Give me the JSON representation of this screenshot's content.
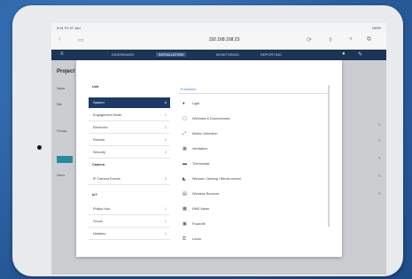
{
  "device": {
    "name": "tablet"
  },
  "statusbar": {
    "time": "9:41  Fri 27 Jan",
    "battery": "100%"
  },
  "browser": {
    "url": "192.168.168.23",
    "icons": [
      "back-icon",
      "reload-icon",
      "share-icon",
      "add-tab-icon",
      "tabs-icon"
    ]
  },
  "appnav": {
    "tabs": [
      {
        "label": "DASHBOARD"
      },
      {
        "label": "INSTALLATION",
        "active": true
      },
      {
        "label": "MONITORING"
      },
      {
        "label": "REPORTING"
      }
    ]
  },
  "background_page": {
    "title": "Project",
    "rows": [
      "Name",
      "Site",
      "Groups",
      "Users"
    ]
  },
  "modal": {
    "left_sections": [
      {
        "title": "Unit",
        "items": [
          {
            "label": "System",
            "count": "6",
            "active": true
          },
          {
            "label": "Engagement Mode",
            "count": "1"
          },
          {
            "label": "Electronic",
            "count": "2"
          },
          {
            "label": "Remote",
            "count": "2"
          },
          {
            "label": "Security",
            "count": "2"
          }
        ]
      },
      {
        "title": "Camera",
        "items": [
          {
            "label": "IP Camera Events",
            "count": "3"
          }
        ]
      },
      {
        "title": "IoT",
        "items": [
          {
            "label": "Philips Hue",
            "count": "1"
          },
          {
            "label": "Sonos",
            "count": "1"
          },
          {
            "label": "Netatmo",
            "count": "1"
          }
        ]
      }
    ],
    "right_header": "Functions",
    "right_items": [
      {
        "icon": "light-icon",
        "label": "Light"
      },
      {
        "icon": "window-icon",
        "label": "Windows & Doorcontacts"
      },
      {
        "icon": "motion-icon",
        "label": "Motion Detection"
      },
      {
        "icon": "ventilation-icon",
        "label": "Ventilation"
      },
      {
        "icon": "thermostat-icon",
        "label": "Thermostat"
      },
      {
        "icon": "window-blinds-icon",
        "label": "Window / Awning / Blinds control"
      },
      {
        "icon": "wireless-relay-icon",
        "label": "Wireless Receiver"
      },
      {
        "icon": "keypad-icon",
        "label": "RMS Meter"
      },
      {
        "icon": "socket-icon",
        "label": "Powerlift"
      },
      {
        "icon": "lock-icon",
        "label": "Locks"
      }
    ]
  }
}
